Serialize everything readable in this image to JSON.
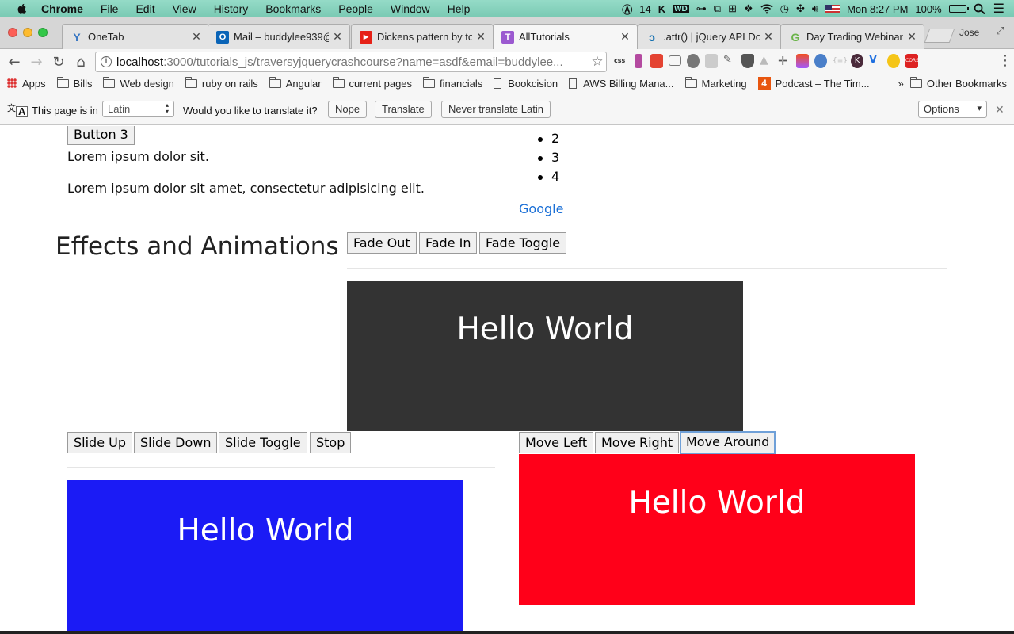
{
  "menubar": {
    "items": [
      "Chrome",
      "File",
      "Edit",
      "View",
      "History",
      "Bookmarks",
      "People",
      "Window",
      "Help"
    ],
    "status_count": "14",
    "clock": "Mon 8:27 PM",
    "battery": "100%"
  },
  "tabs": [
    {
      "title": "OneTab",
      "favicon": "onetab-icon",
      "color": "#3a78c3"
    },
    {
      "title": "Mail – buddylee939@",
      "favicon": "outlook-icon",
      "color": "#0a64b7"
    },
    {
      "title": "Dickens pattern by to",
      "favicon": "youtube-icon",
      "color": "#e62117"
    },
    {
      "title": "AllTutorials",
      "favicon": "alltutorials-icon",
      "color": "#9b59d0"
    },
    {
      "title": ".attr() | jQuery API Do",
      "favicon": "jquery-icon",
      "color": "#0769ad"
    },
    {
      "title": "Day Trading Webinar",
      "favicon": "g-icon",
      "color": "#6bb44a"
    }
  ],
  "profile_name": "Jose",
  "omnibox": {
    "host": "localhost",
    "path": ":3000/tutorials_js/traversyjquerycrashcourse?name=asdf&email=buddylee..."
  },
  "bookmarks": [
    {
      "label": "Apps",
      "kind": "apps"
    },
    {
      "label": "Bills",
      "kind": "folder"
    },
    {
      "label": "Web design",
      "kind": "folder"
    },
    {
      "label": "ruby on rails",
      "kind": "folder"
    },
    {
      "label": "Angular",
      "kind": "folder"
    },
    {
      "label": "current pages",
      "kind": "folder"
    },
    {
      "label": "financials",
      "kind": "folder"
    },
    {
      "label": "Bookcision",
      "kind": "page"
    },
    {
      "label": "AWS Billing Mana...",
      "kind": "page"
    },
    {
      "label": "Marketing",
      "kind": "folder"
    },
    {
      "label": "Podcast – The Tim...",
      "kind": "numbered"
    }
  ],
  "bookmarks_overflow": "»",
  "other_bookmarks": "Other Bookmarks",
  "translate": {
    "prefix": "This page is in",
    "language": "Latin",
    "question": "Would you like to translate it?",
    "nope": "Nope",
    "translate": "Translate",
    "never": "Never translate Latin",
    "options": "Options"
  },
  "page": {
    "button3": "Button 3",
    "lorem_short": "Lorem ipsum dolor sit.",
    "lorem_long": "Lorem ipsum dolor sit amet, consectetur adipisicing elit.",
    "list_items": [
      "2",
      "3",
      "4"
    ],
    "link_google": "Google",
    "effects_heading": "Effects and Animations",
    "fade_buttons": [
      "Fade Out",
      "Fade In",
      "Fade Toggle"
    ],
    "slide_buttons": [
      "Slide Up",
      "Slide Down",
      "Slide Toggle",
      "Stop"
    ],
    "move_buttons": [
      "Move Left",
      "Move Right",
      "Move Around"
    ],
    "boxes": [
      {
        "text": "Hello World",
        "color": "#333333"
      },
      {
        "text": "Hello World",
        "color": "#1b1bf5"
      },
      {
        "text": "Hello World",
        "color": "#ff0019"
      }
    ]
  }
}
